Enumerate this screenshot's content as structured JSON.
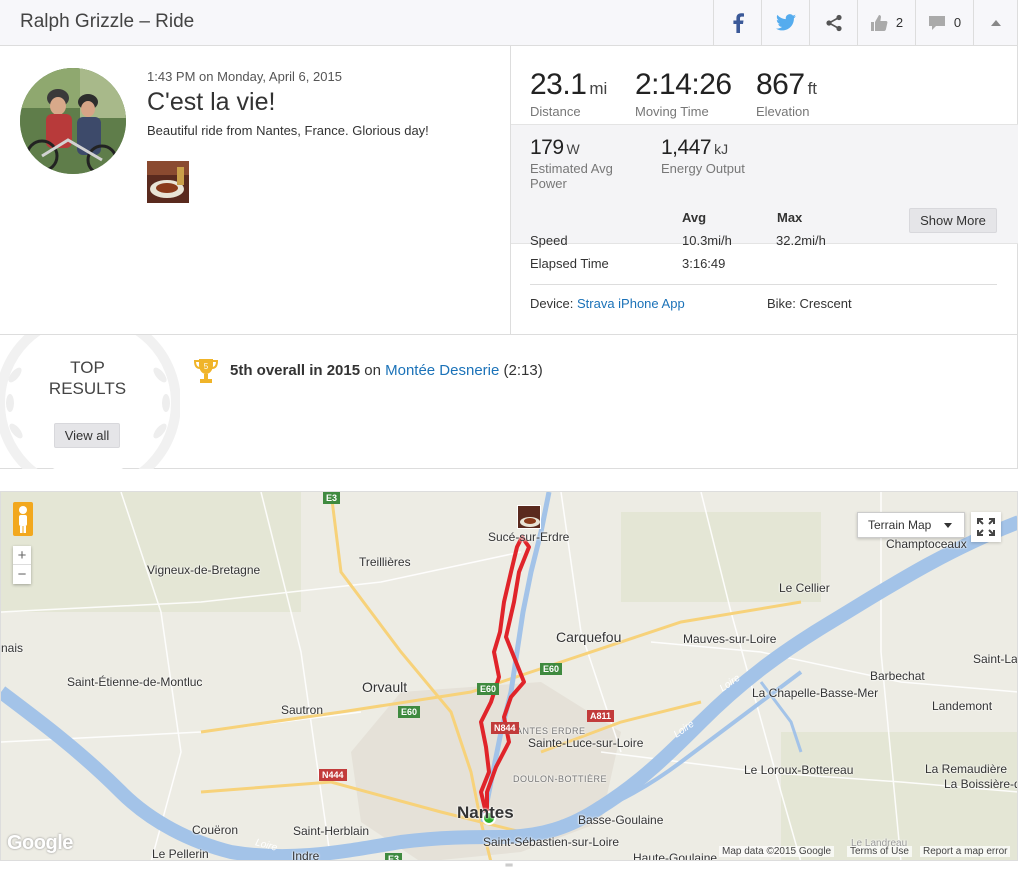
{
  "header": {
    "title": "Ralph Grizzle – Ride",
    "kudos_count": "2",
    "comment_count": "0"
  },
  "activity": {
    "time": "1:43 PM",
    "date_connector": "on",
    "date": "Monday, April 6, 2015",
    "title": "C'est la vie!",
    "description": "Beautiful ride from Nantes, France. Glorious day!"
  },
  "stats": {
    "distance": {
      "value": "23.1",
      "unit": "mi",
      "label": "Distance"
    },
    "moving_time": {
      "value": "2:14:26",
      "label": "Moving Time"
    },
    "elevation": {
      "value": "867",
      "unit": "ft",
      "label": "Elevation"
    },
    "power": {
      "value": "179",
      "unit": "W",
      "label": "Estimated Avg Power"
    },
    "energy": {
      "value": "1,447",
      "unit": "kJ",
      "label": "Energy Output"
    },
    "table": {
      "col_avg": "Avg",
      "col_max": "Max",
      "rows": [
        {
          "label": "Speed",
          "avg": "10.3mi/h",
          "max": "32.2mi/h"
        },
        {
          "label": "Elapsed Time",
          "avg": "3:16:49",
          "max": ""
        }
      ]
    },
    "show_more_label": "Show More",
    "device_label": "Device:",
    "device_value": "Strava iPhone App",
    "bike_label": "Bike:",
    "bike_value": "Crescent"
  },
  "results": {
    "title_line1": "TOP",
    "title_line2": "RESULTS",
    "view_all_label": "View all",
    "trophy_rank": "5",
    "achievement": "5th overall in 2015",
    "connector": "on",
    "segment": "Montée Desnerie",
    "segment_time": "(2:13)"
  },
  "map": {
    "map_type_label": "Terrain Map",
    "zoom_in": "+",
    "zoom_out": "−",
    "google": "Google",
    "attribution": "Map data ©2015 Google",
    "terms": "Terms of Use",
    "report": "Report a map error",
    "places": [
      "Sucé-sur-Erdre",
      "Champtoceaux",
      "Treillières",
      "Vigneux-de-Bretagne",
      "Le Cellier",
      "Carquefou",
      "Mauves-sur-Loire",
      "Saint-La",
      "Barbechat",
      "Saint-Étienne-de-Montluc",
      "Orvault",
      "La Chapelle-Basse-Mer",
      "Sautron",
      "Landemont",
      "Sainte-Luce-sur-Loire",
      "Le Loroux-Bottereau",
      "La Remaudière",
      "La Boissière-d",
      "Nantes",
      "Basse-Goulaine",
      "Couëron",
      "Saint-Herblain",
      "Saint-Sébastien-sur-Loire",
      "Le Pellerin",
      "Indre",
      "Haute-Goulaine",
      "nais",
      "Le Landreau"
    ],
    "areas": [
      "NANTES ERDRE",
      "DOULON-BOTTIÈRE"
    ],
    "roads": [
      "E3",
      "E60",
      "E60",
      "E60",
      "A811",
      "N844",
      "N444",
      "E3"
    ],
    "river": "Loire"
  },
  "colors": {
    "link": "#1b72b8",
    "route": "#e0242a",
    "trophy": "#f0b429",
    "water": "#a3c3e8"
  }
}
